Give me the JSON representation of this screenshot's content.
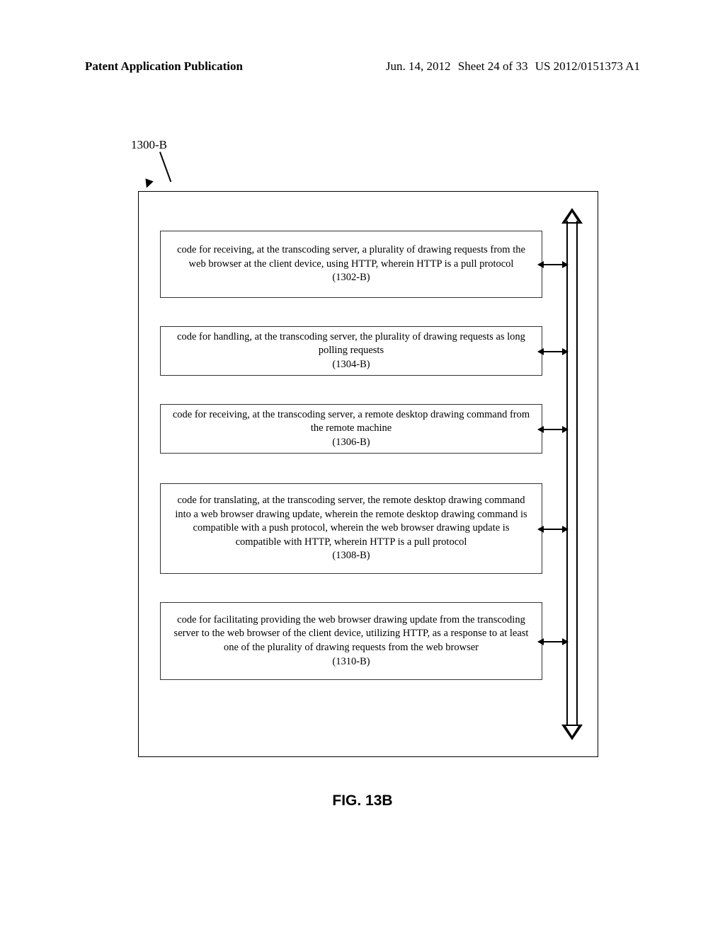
{
  "header": {
    "left": "Patent Application Publication",
    "date": "Jun. 14, 2012",
    "sheet": "Sheet 24 of 33",
    "pubno": "US 2012/0151373 A1"
  },
  "figure": {
    "label": "1300-B",
    "caption": "FIG. 13B"
  },
  "blocks": [
    {
      "text": "code for receiving, at the transcoding server, a plurality of drawing requests from the web browser at the client device, using HTTP, wherein HTTP is a pull protocol",
      "id": "(1302-B)"
    },
    {
      "text": "code for handling, at the transcoding server, the plurality of drawing requests as long polling requests",
      "id": "(1304-B)"
    },
    {
      "text": "code for receiving, at the transcoding server, a remote desktop drawing command from the remote machine",
      "id": "(1306-B)"
    },
    {
      "text": "code for translating, at the transcoding server, the remote desktop drawing command into a web browser drawing update, wherein the remote desktop drawing command is compatible with a push protocol, wherein the web browser drawing update is compatible with HTTP, wherein HTTP is a pull protocol",
      "id": "(1308-B)"
    },
    {
      "text": "code for facilitating providing the web browser drawing update from the transcoding server to the web browser of the client device, utilizing HTTP, as a response to at least one of the plurality of drawing requests from the web browser",
      "id": "(1310-B)"
    }
  ]
}
